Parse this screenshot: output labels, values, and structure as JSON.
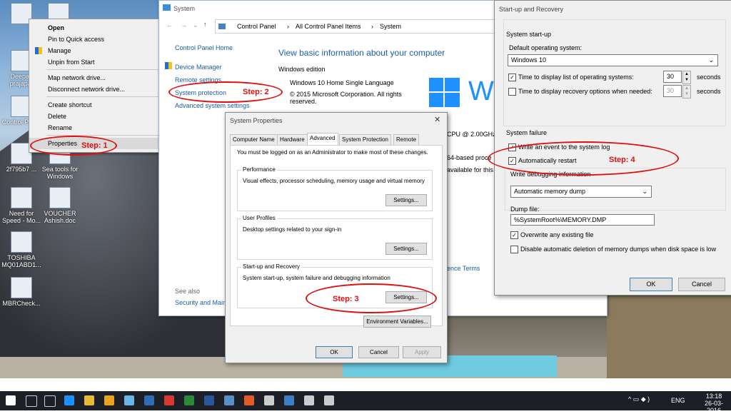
{
  "desktop": {
    "icons": [
      {
        "label": "Deepak\nprajapat"
      },
      {
        "label": "Control\nPanel"
      },
      {
        "label": "2f795b7 ..."
      },
      {
        "label": "Need for\nSpeed - Mo..."
      },
      {
        "label": "TOSHIBA\nMQ01ABD1..."
      },
      {
        "label": "MBRCheck..."
      },
      {
        "label": "Sea tools for\nWindows"
      },
      {
        "label": "VOUCHER\nAshish.doc"
      }
    ]
  },
  "context_menu": {
    "items": [
      "Open",
      "Pin to Quick access",
      "Manage",
      "Unpin from Start",
      "Map network drive...",
      "Disconnect network drive...",
      "Create shortcut",
      "Delete",
      "Rename",
      "Properties"
    ]
  },
  "control_panel": {
    "title": "System",
    "breadcrumb": [
      "Control Panel",
      "All Control Panel Items",
      "System"
    ],
    "sidebar": [
      "Control Panel Home",
      "Device Manager",
      "Remote settings",
      "System protection",
      "Advanced system settings"
    ],
    "see_also": "See also",
    "security": "Security and Main",
    "heading": "View basic information about your computer",
    "edition_label": "Windows edition",
    "edition": "Windows 10 Home Single Language",
    "copyright": "© 2015 Microsoft Corporation. All rights reserved.",
    "cpu_fragment": "CPU @ 2.00GHz",
    "bit_fragment": "64-based proce",
    "available_fragment": "available for this D",
    "license_fragment": "ence Terms",
    "logo_letter": "W"
  },
  "system_properties": {
    "title": "System Properties",
    "tabs": [
      "Computer Name",
      "Hardware",
      "Advanced",
      "System Protection",
      "Remote"
    ],
    "admin_note": "You must be logged on as an Administrator to make most of these changes.",
    "performance": {
      "title": "Performance",
      "desc": "Visual effects, processor scheduling, memory usage and virtual memory",
      "button": "Settings..."
    },
    "profiles": {
      "title": "User Profiles",
      "desc": "Desktop settings related to your sign-in",
      "button": "Settings..."
    },
    "startup": {
      "title": "Start-up and Recovery",
      "desc": "System start-up, system failure and debugging information",
      "button": "Settings..."
    },
    "env_button": "Environment Variables...",
    "ok": "OK",
    "cancel": "Cancel",
    "apply": "Apply"
  },
  "startup_recovery": {
    "title": "Start-up and Recovery",
    "startup_group": "System start-up",
    "default_os_label": "Default operating system:",
    "default_os": "Windows 10",
    "display_list_label": "Time to display list of operating systems:",
    "display_list_value": "30",
    "display_recovery_label": "Time to display recovery options when needed:",
    "display_recovery_value": "30",
    "seconds": "seconds",
    "failure_group": "System failure",
    "write_event": "Write an event to the system log",
    "auto_restart": "Automatically restart",
    "debug_label": "Write debugging information",
    "debug_value": "Automatic memory dump",
    "dump_label": "Dump file:",
    "dump_value": "%SystemRoot%\\MEMORY.DMP",
    "overwrite": "Overwrite any existing file",
    "disable_auto_delete": "Disable automatic deletion of memory dumps when disk space is low",
    "ok": "OK",
    "cancel": "Cancel"
  },
  "annotations": {
    "step1": "Step: 1",
    "step2": "Step: 2",
    "step3": "Step: 3",
    "step4": "Step: 4"
  },
  "taskbar": {
    "language": "ENG",
    "time": "13:18",
    "date": "26-03-2016"
  },
  "colors": {
    "annotation": "#e01010",
    "link": "#1a5ea8",
    "win_blue": "#1e90ff"
  }
}
